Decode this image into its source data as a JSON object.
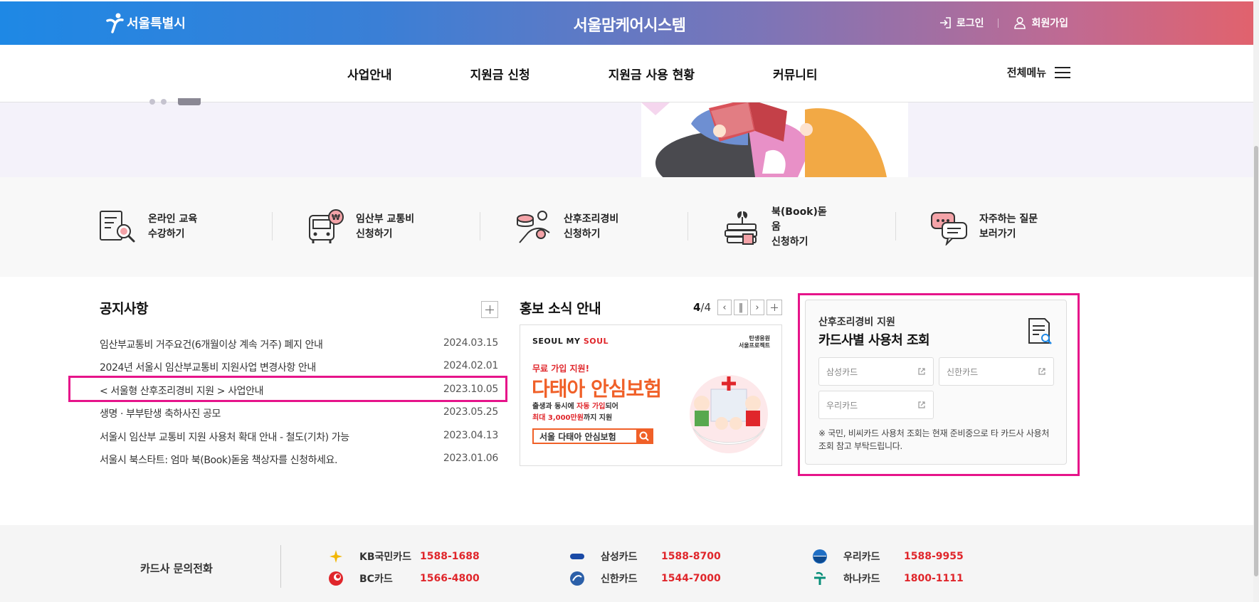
{
  "header": {
    "logo_text": "서울특별시",
    "site_title": "서울맘케어시스템",
    "login_label": "로그인",
    "signup_label": "회원가입"
  },
  "nav": {
    "items": [
      {
        "label": "사업안내"
      },
      {
        "label": "지원금 신청"
      },
      {
        "label": "지원금 사용 현황"
      },
      {
        "label": "커뮤니티"
      }
    ],
    "all_menu_label": "전체메뉴"
  },
  "quick_links": [
    {
      "line1": "온라인 교육",
      "line2": "수강하기",
      "icon": "online-education-icon"
    },
    {
      "line1": "임산부 교통비",
      "line2": "신청하기",
      "icon": "bus-icon"
    },
    {
      "line1": "산후조리경비",
      "line2": "신청하기",
      "icon": "postpartum-care-icon"
    },
    {
      "line1": "북(Book)돋움",
      "line2": "신청하기",
      "icon": "book-icon"
    },
    {
      "line1": "자주하는 질문",
      "line2": "보러가기",
      "icon": "faq-chat-icon"
    }
  ],
  "notice": {
    "title": "공지사항",
    "items": [
      {
        "title": "임산부교통비 거주요건(6개월이상 계속 거주) 폐지 안내",
        "date": "2024.03.15"
      },
      {
        "title": "2024년 서울시 임산부교통비 지원사업 변경사항 안내",
        "date": "2024.02.01"
      },
      {
        "title": "< 서울형 산후조리경비 지원 > 사업안내",
        "date": "2023.10.05"
      },
      {
        "title": "생명 · 부부탄생 축하사진 공모",
        "date": "2023.05.25"
      },
      {
        "title": "서울시 임산부 교통비 지원 사용처 확대 안내 - 철도(기차) 가능",
        "date": "2023.04.13"
      },
      {
        "title": "서울시 북스타트: 엄마 북(Book)돋움 책상자를 신청하세요.",
        "date": "2023.01.06"
      }
    ]
  },
  "promo": {
    "title": "홍보 소식 안내",
    "pager_current": "4",
    "pager_total": "/4",
    "banner": {
      "brand_a": "SEOUL MY ",
      "brand_b": "SOUL",
      "badge_line1": "탄생응원",
      "badge_line2": "서울프로젝트",
      "subtitle": "무료 가입 지원!",
      "headline": "다태아 안심보험",
      "desc_line1_a": "출생과 동시에 ",
      "desc_line1_b": "자동 가입",
      "desc_line1_c": "되어",
      "desc_line2_a": "최대 3,000만원",
      "desc_line2_b": "까지 지원",
      "search_text": "서울 다태아 안심보험"
    }
  },
  "card_search": {
    "subtitle": "산후조리경비 지원",
    "title": "카드사별 사용처 조회",
    "buttons": [
      {
        "label": "삼성카드"
      },
      {
        "label": "신한카드"
      },
      {
        "label": "우리카드"
      }
    ],
    "note": "※ 국민, 비씨카드 사용처 조회는 현재 준비중으로 타 카드사 사용처 조회 참고 부탁드립니다."
  },
  "footer": {
    "label": "카드사 문의전화",
    "cards": [
      {
        "name": "KB국민카드",
        "phone": "1588-1688"
      },
      {
        "name": "BC카드",
        "phone": "1566-4800"
      },
      {
        "name": "삼성카드",
        "phone": "1588-8700"
      },
      {
        "name": "신한카드",
        "phone": "1544-7000"
      },
      {
        "name": "우리카드",
        "phone": "1588-9955"
      },
      {
        "name": "하나카드",
        "phone": "1800-1111"
      }
    ]
  },
  "colors": {
    "highlight": "#e6148a",
    "phone": "#e0262b",
    "gradient_start": "#1e88e5",
    "gradient_end": "#e2626c"
  }
}
